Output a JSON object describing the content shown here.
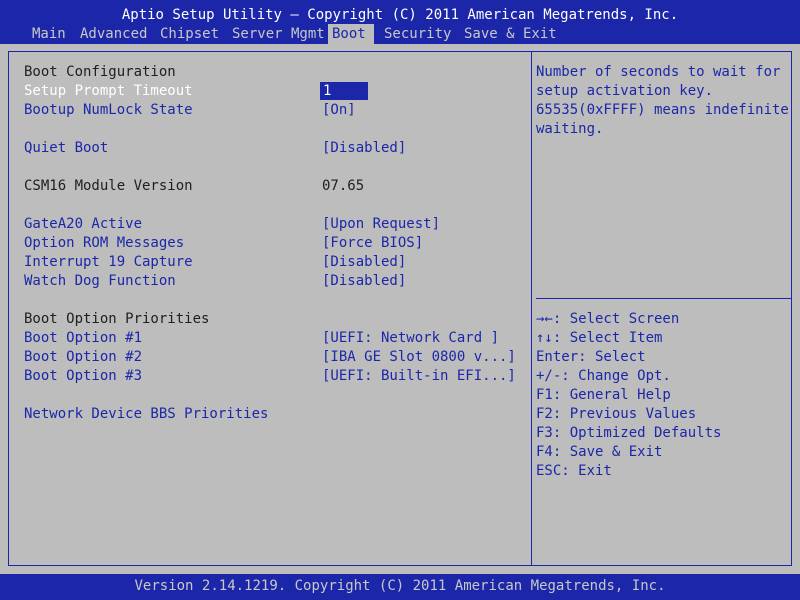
{
  "title": "Aptio Setup Utility – Copyright (C) 2011 American Megatrends, Inc.",
  "menu": {
    "items": [
      "Main",
      "Advanced",
      "Chipset",
      "Server Mgmt",
      "Boot",
      "Security",
      "Save & Exit"
    ],
    "active": "Boot"
  },
  "settings": {
    "boot_config_heading": "Boot Configuration",
    "setup_prompt_timeout": {
      "label": "Setup Prompt Timeout",
      "value": "1"
    },
    "bootup_numlock": {
      "label": "Bootup NumLock State",
      "value": "[On]"
    },
    "quiet_boot": {
      "label": "Quiet Boot",
      "value": "[Disabled]"
    },
    "csm16": {
      "label": "CSM16 Module Version",
      "value": "07.65"
    },
    "gatea20": {
      "label": "GateA20 Active",
      "value": "[Upon Request]"
    },
    "option_rom": {
      "label": "Option ROM Messages",
      "value": "[Force BIOS]"
    },
    "int19": {
      "label": "Interrupt 19 Capture",
      "value": "[Disabled]"
    },
    "watchdog": {
      "label": "Watch Dog Function",
      "value": "[Disabled]"
    },
    "priorities_heading": "Boot Option Priorities",
    "boot1": {
      "label": "Boot Option #1",
      "value": "[UEFI: Network Card ]"
    },
    "boot2": {
      "label": "Boot Option #2",
      "value": "[IBA GE Slot 0800 v...]"
    },
    "boot3": {
      "label": "Boot Option #3",
      "value": "[UEFI: Built-in EFI...]"
    },
    "network_bbs": {
      "label": "Network Device BBS Priorities"
    }
  },
  "help": {
    "lines": [
      "Number of seconds to wait for",
      "setup activation key.",
      "65535(0xFFFF) means indefinite",
      "waiting."
    ]
  },
  "keys": [
    "→←: Select Screen",
    "↑↓: Select Item",
    "Enter: Select",
    "+/-: Change Opt.",
    "F1: General Help",
    "F2: Previous Values",
    "F3: Optimized Defaults",
    "F4: Save & Exit",
    "ESC: Exit"
  ],
  "footer": "Version 2.14.1219. Copyright (C) 2011 American Megatrends, Inc."
}
